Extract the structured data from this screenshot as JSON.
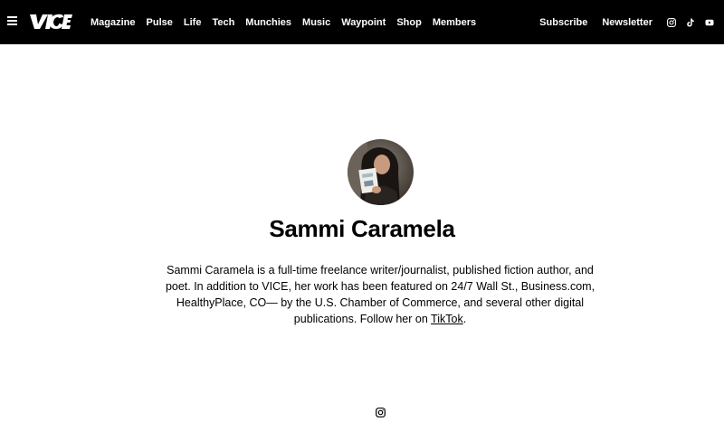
{
  "header": {
    "logo_icon": "vice-logo",
    "menu_icon": "hamburger-menu-icon",
    "nav_items": [
      {
        "label": "Magazine"
      },
      {
        "label": "Pulse"
      },
      {
        "label": "Life"
      },
      {
        "label": "Tech"
      },
      {
        "label": "Munchies"
      },
      {
        "label": "Music"
      },
      {
        "label": "Waypoint"
      },
      {
        "label": "Shop"
      },
      {
        "label": "Members"
      }
    ],
    "subscribe_label": "Subscribe",
    "newsletter_label": "Newsletter",
    "social_icons": [
      "instagram-icon",
      "tiktok-icon",
      "youtube-icon"
    ]
  },
  "author": {
    "name": "Sammi Caramela",
    "avatar_icon": "author-avatar",
    "bio_text": "Sammi Caramela is a full-time freelance writer/journalist, published fiction author, and poet. In addition to VICE, her work has been featured on 24/7 Wall St., Business.com, HealthyPlace, CO— by the U.S. Chamber of Commerce, and several other digital publications. Follow her on ",
    "bio_link": "TikTok",
    "bio_end": ".",
    "social_icon": "instagram-icon"
  },
  "colors": {
    "nav_background": "#000000",
    "nav_text": "#ffffff",
    "page_background": "#ffffff"
  }
}
